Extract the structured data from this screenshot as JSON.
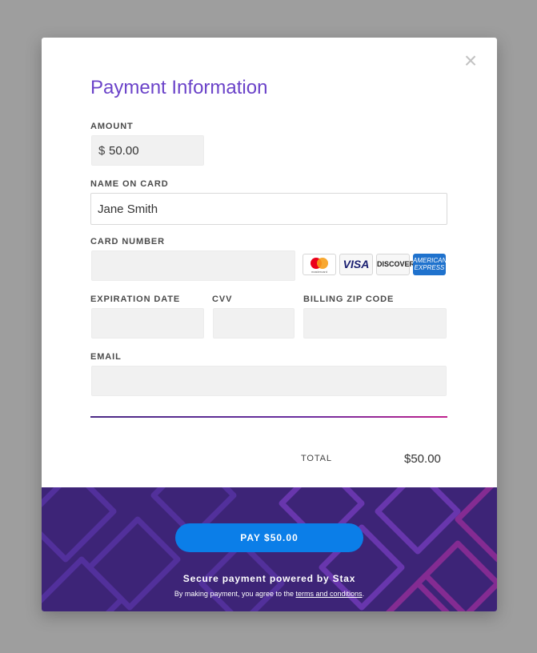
{
  "modal": {
    "close_icon": "×",
    "title": "Payment Information"
  },
  "amount": {
    "label": "AMOUNT",
    "currency_symbol": "$",
    "value": "50.00"
  },
  "name_on_card": {
    "label": "NAME ON CARD",
    "value": "Jane Smith"
  },
  "card_number": {
    "label": "CARD NUMBER",
    "value": ""
  },
  "card_brands": [
    {
      "name": "mastercard-icon",
      "text": "mastercard"
    },
    {
      "name": "visa-icon",
      "text": "VISA"
    },
    {
      "name": "discover-icon",
      "text": "DISCOVER"
    },
    {
      "name": "amex-icon",
      "text": "AMERICAN EXPRESS"
    }
  ],
  "expiration": {
    "label": "EXPIRATION DATE",
    "value": ""
  },
  "cvv": {
    "label": "CVV",
    "value": ""
  },
  "zip": {
    "label": "BILLING ZIP CODE",
    "value": ""
  },
  "email": {
    "label": "EMAIL",
    "value": ""
  },
  "total": {
    "label": "TOTAL",
    "value": "$50.00"
  },
  "footer": {
    "pay_button": "PAY $50.00",
    "powered_by": "Secure payment powered by Stax",
    "terms_prefix": "By making payment, you agree to the ",
    "terms_link": "terms and conditions",
    "terms_suffix": "."
  },
  "colors": {
    "accent": "#6b43c9",
    "pay_button": "#0b7ee8",
    "footer_bg": "#3d2477",
    "overlay": "#9e9e9e"
  }
}
